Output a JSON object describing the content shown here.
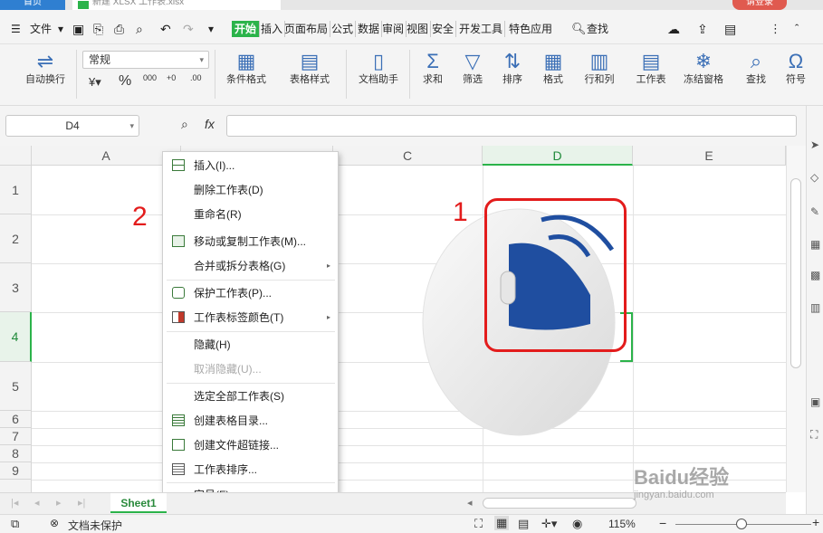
{
  "tabstrip": {
    "home_tab": "首页",
    "file_tab": "新建 XLSX 工作表.xlsx",
    "login": "请登录"
  },
  "menubar": {
    "file_label": "文件",
    "tabs": [
      "开始",
      "插入",
      "页面布局",
      "公式",
      "数据",
      "审阅",
      "视图",
      "安全",
      "开发工具",
      "特色应用"
    ],
    "active_tab": "开始",
    "search_label": "查找"
  },
  "ribbon": {
    "autowrap": "自动换行",
    "number_format": "常规",
    "conditional_format": "条件格式",
    "table_style": "表格样式",
    "doc_assistant": "文档助手",
    "sum": "求和",
    "filter": "筛选",
    "sort": "排序",
    "format": "格式",
    "row_col": "行和列",
    "worksheet": "工作表",
    "freeze": "冻结窗格",
    "find": "查找",
    "symbol": "符号"
  },
  "formulabar": {
    "cell_ref": "D4",
    "fx": "fx",
    "value": ""
  },
  "grid": {
    "columns": [
      "A",
      "B",
      "C",
      "D",
      "E"
    ],
    "rows": [
      "1",
      "2",
      "3",
      "4",
      "5",
      "6",
      "7",
      "8",
      "9"
    ],
    "selected_column": "D",
    "selected_row": "4"
  },
  "context_menu": {
    "items": [
      {
        "label": "插入(I)...",
        "disabled": false
      },
      {
        "label": "删除工作表(D)",
        "disabled": false
      },
      {
        "label": "重命名(R)",
        "disabled": false
      },
      {
        "label": "移动或复制工作表(M)...",
        "disabled": false
      },
      {
        "label": "合并或拆分表格(G)",
        "disabled": false
      },
      {
        "label": "保护工作表(P)...",
        "disabled": false
      },
      {
        "label": "工作表标签颜色(T)",
        "disabled": false
      },
      {
        "label": "隐藏(H)",
        "disabled": false
      },
      {
        "label": "取消隐藏(U)...",
        "disabled": true
      },
      {
        "label": "选定全部工作表(S)",
        "disabled": false
      },
      {
        "label": "创建表格目录...",
        "disabled": false
      },
      {
        "label": "创建文件超链接...",
        "disabled": false
      },
      {
        "label": "工作表排序...",
        "disabled": false
      },
      {
        "label": "字号(F)",
        "disabled": false
      }
    ],
    "submenu_arrow": "▸"
  },
  "annotations": {
    "step1": "1",
    "step2": "2"
  },
  "sheets": {
    "active": "Sheet1"
  },
  "statusbar": {
    "doc_protect": "文档未保护",
    "zoom": "115%"
  },
  "watermark": {
    "main": "Baidu经验",
    "sub": "jingyan.baidu.com"
  },
  "colors": {
    "accent_green": "#2bb34a",
    "annotation_red": "#e31c1c",
    "mouse_blue": "#1f4ea0"
  }
}
